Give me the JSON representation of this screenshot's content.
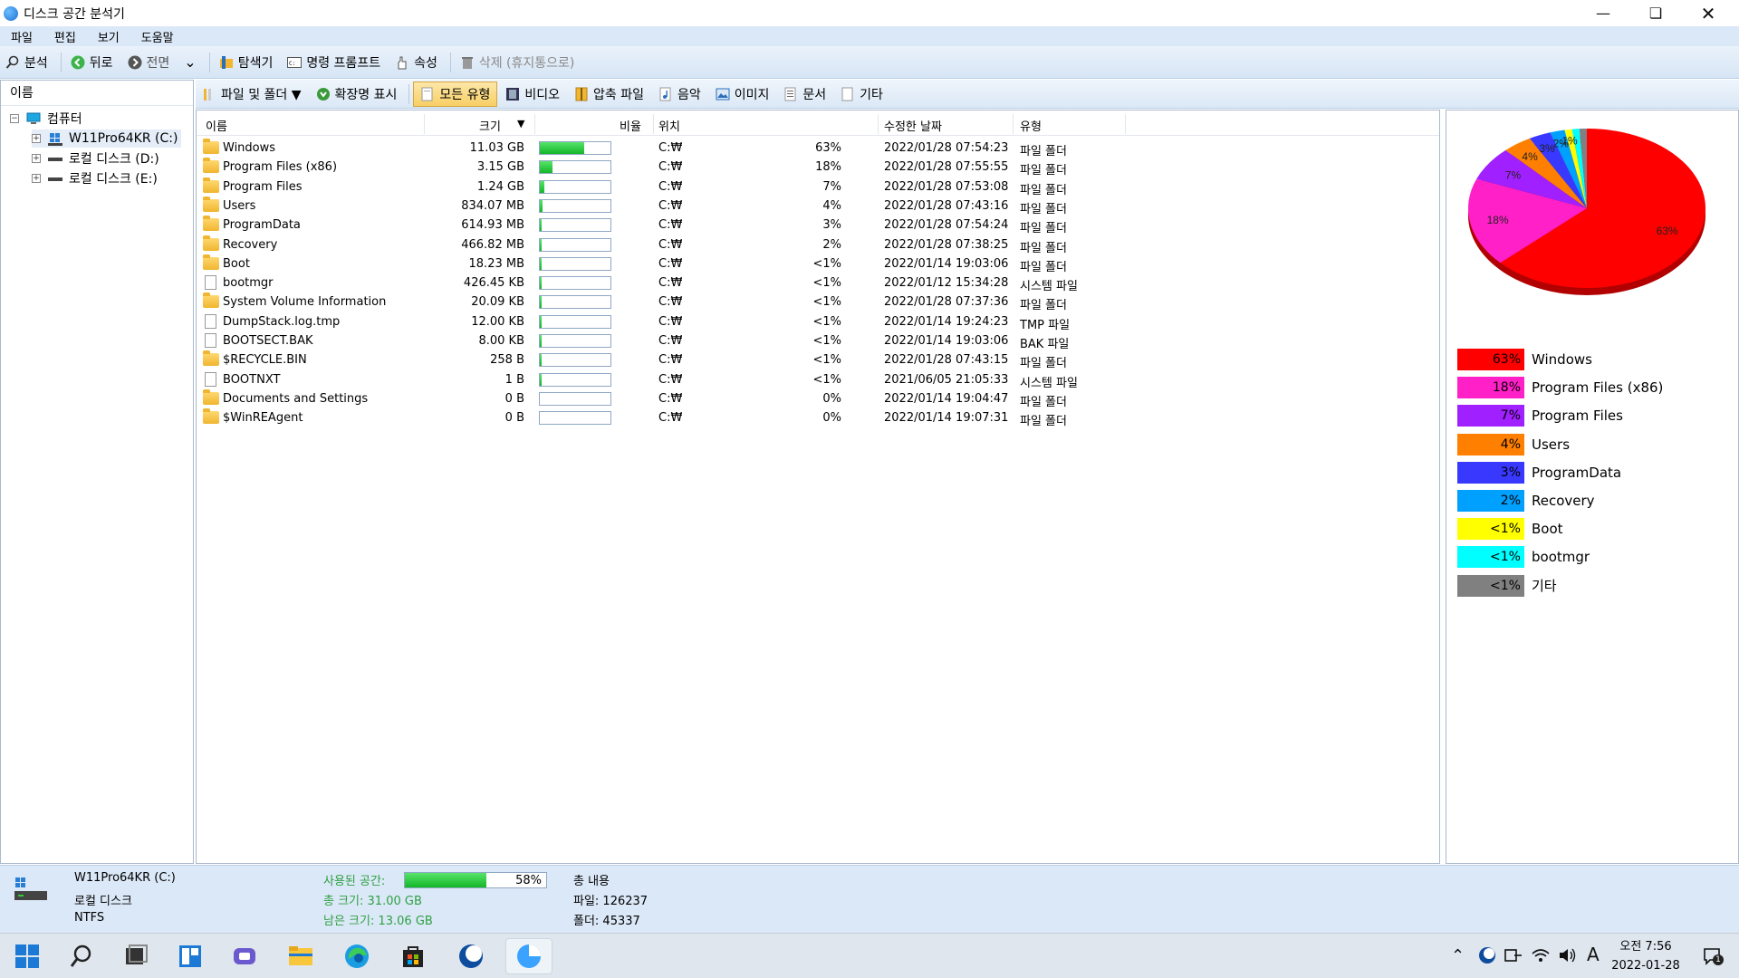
{
  "window": {
    "title": "디스크 공간 분석기"
  },
  "menu": [
    "파일",
    "편집",
    "보기",
    "도움말"
  ],
  "toolbar": {
    "analyze": "분석",
    "back": "뒤로",
    "forward": "전면",
    "explorer": "탐색기",
    "cmd": "명령 프롬프트",
    "properties": "속성",
    "delete": "삭제 (휴지통으로)"
  },
  "tree": {
    "header": "이름",
    "root": "컴퓨터",
    "drives": [
      "W11Pro64KR (C:)",
      "로컬 디스크 (D:)",
      "로컬 디스크 (E:)"
    ]
  },
  "filters": {
    "files_folders": "파일 및 폴더 ▼",
    "show_ext": "확장명 표시",
    "all_types": "모든 유형",
    "video": "비디오",
    "compressed": "압축 파일",
    "music": "음악",
    "images": "이미지",
    "documents": "문서",
    "other": "기타"
  },
  "columns": {
    "name": "이름",
    "size": "크기",
    "ratio": "비율",
    "location": "위치",
    "modified": "수정한 날짜",
    "type": "유형"
  },
  "rows": [
    {
      "name": "Windows",
      "size": "11.03 GB",
      "pct": "63%",
      "fill": 0.63,
      "loc": "C:₩",
      "date": "2022/01/28 07:54:23",
      "type": "파일 폴더",
      "icon": "folder"
    },
    {
      "name": "Program Files (x86)",
      "size": "3.15 GB",
      "pct": "18%",
      "fill": 0.18,
      "loc": "C:₩",
      "date": "2022/01/28 07:55:55",
      "type": "파일 폴더",
      "icon": "folder"
    },
    {
      "name": "Program Files",
      "size": "1.24 GB",
      "pct": "7%",
      "fill": 0.07,
      "loc": "C:₩",
      "date": "2022/01/28 07:53:08",
      "type": "파일 폴더",
      "icon": "folder"
    },
    {
      "name": "Users",
      "size": "834.07 MB",
      "pct": "4%",
      "fill": 0.04,
      "loc": "C:₩",
      "date": "2022/01/28 07:43:16",
      "type": "파일 폴더",
      "icon": "folder"
    },
    {
      "name": "ProgramData",
      "size": "614.93 MB",
      "pct": "3%",
      "fill": 0.03,
      "loc": "C:₩",
      "date": "2022/01/28 07:54:24",
      "type": "파일 폴더",
      "icon": "folder"
    },
    {
      "name": "Recovery",
      "size": "466.82 MB",
      "pct": "2%",
      "fill": 0.02,
      "loc": "C:₩",
      "date": "2022/01/28 07:38:25",
      "type": "파일 폴더",
      "icon": "folder"
    },
    {
      "name": "Boot",
      "size": "18.23 MB",
      "pct": "<1%",
      "fill": 0.01,
      "loc": "C:₩",
      "date": "2022/01/14 19:03:06",
      "type": "파일 폴더",
      "icon": "folder"
    },
    {
      "name": "bootmgr",
      "size": "426.45 KB",
      "pct": "<1%",
      "fill": 0.01,
      "loc": "C:₩",
      "date": "2022/01/12 15:34:28",
      "type": "시스템 파일",
      "icon": "file"
    },
    {
      "name": "System Volume Information",
      "size": "20.09 KB",
      "pct": "<1%",
      "fill": 0.01,
      "loc": "C:₩",
      "date": "2022/01/28 07:37:36",
      "type": "파일 폴더",
      "icon": "folder"
    },
    {
      "name": "DumpStack.log.tmp",
      "size": "12.00 KB",
      "pct": "<1%",
      "fill": 0.01,
      "loc": "C:₩",
      "date": "2022/01/14 19:24:23",
      "type": "TMP 파일",
      "icon": "file"
    },
    {
      "name": "BOOTSECT.BAK",
      "size": "8.00 KB",
      "pct": "<1%",
      "fill": 0.01,
      "loc": "C:₩",
      "date": "2022/01/14 19:03:06",
      "type": "BAK 파일",
      "icon": "file"
    },
    {
      "name": "$RECYCLE.BIN",
      "size": "258 B",
      "pct": "<1%",
      "fill": 0.01,
      "loc": "C:₩",
      "date": "2022/01/28 07:43:15",
      "type": "파일 폴더",
      "icon": "folder"
    },
    {
      "name": "BOOTNXT",
      "size": "1 B",
      "pct": "<1%",
      "fill": 0.01,
      "loc": "C:₩",
      "date": "2021/06/05 21:05:33",
      "type": "시스템 파일",
      "icon": "file"
    },
    {
      "name": "Documents and Settings",
      "size": "0 B",
      "pct": "0%",
      "fill": 0,
      "loc": "C:₩",
      "date": "2022/01/14 19:04:47",
      "type": "파일 폴더",
      "icon": "folder"
    },
    {
      "name": "$WinREAgent",
      "size": "0 B",
      "pct": "0%",
      "fill": 0,
      "loc": "C:₩",
      "date": "2022/01/14 19:07:31",
      "type": "파일 폴더",
      "icon": "folder"
    }
  ],
  "legend": [
    {
      "pct": "63%",
      "label": "Windows",
      "color": "#ff0000"
    },
    {
      "pct": "18%",
      "label": "Program Files (x86)",
      "color": "#ff20c8"
    },
    {
      "pct": "7%",
      "label": "Program Files",
      "color": "#a020ff"
    },
    {
      "pct": "4%",
      "label": "Users",
      "color": "#ff8000"
    },
    {
      "pct": "3%",
      "label": "ProgramData",
      "color": "#3838ff"
    },
    {
      "pct": "2%",
      "label": "Recovery",
      "color": "#00a0ff"
    },
    {
      "pct": "<1%",
      "label": "Boot",
      "color": "#ffff00"
    },
    {
      "pct": "<1%",
      "label": "bootmgr",
      "color": "#00ffff"
    },
    {
      "pct": "<1%",
      "label": "기타",
      "color": "#808080"
    }
  ],
  "pie": {
    "labels": [
      "63%",
      "18%",
      "7%",
      "4%",
      "3%",
      "2%",
      "1%"
    ]
  },
  "status": {
    "drive": "W11Pro64KR (C:)",
    "drive_type": "로컬 디스크",
    "fs": "NTFS",
    "used_label": "사용된 공간:",
    "used_pct": "58%",
    "used_fill": 0.58,
    "total": "총 크기: 31.00 GB",
    "free": "남은 크기: 13.06 GB",
    "contents": "총 내용",
    "files": "파일: 126237",
    "folders": "폴더: 45337"
  },
  "clock": {
    "time": "오전 7:56",
    "date": "2022-01-28"
  },
  "tray": {
    "ime": "A",
    "notif": "1"
  }
}
